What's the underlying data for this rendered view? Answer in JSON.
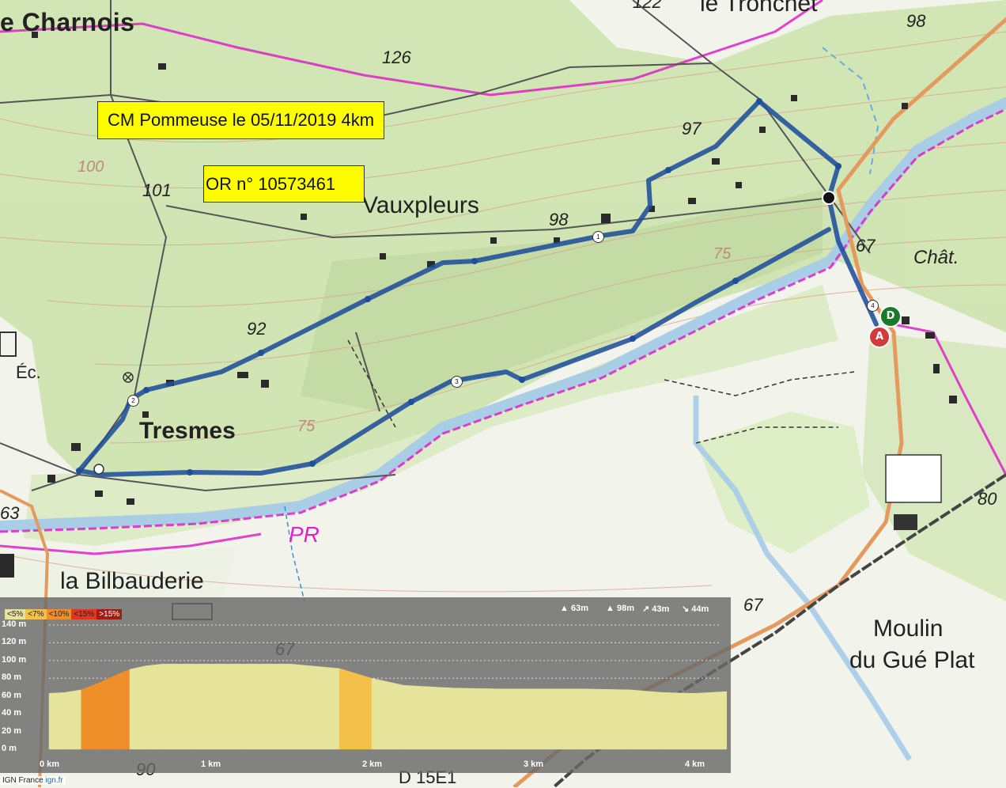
{
  "route": {
    "title": "CM Pommeuse le 05/11/2019 4km",
    "or_number": "OR n° 10573461",
    "color": "#1f4e9c"
  },
  "places": {
    "charnois": "e Charnois",
    "tronchet": "le Tronchet",
    "vauxpleurs": "Vauxpleurs",
    "tresmes": "Tresmes",
    "bilbauderie": "la Bilbauderie",
    "moulin_1": "Moulin",
    "moulin_2": "du Gué Plat",
    "chat": "Chât.",
    "ec": "Éc.",
    "pr": "PR",
    "road": "D 15E1"
  },
  "spot_heights": [
    "126",
    "122",
    "98",
    "97",
    "101",
    "98",
    "92",
    "67",
    "75",
    "75",
    "100",
    "80",
    "67",
    "67",
    "63",
    "90"
  ],
  "markers": {
    "depart": "D",
    "arrivee": "A",
    "waypoints": [
      "1",
      "2",
      "3",
      "4"
    ]
  },
  "elevation_profile": {
    "slope_legend": [
      {
        "label": "<5%",
        "color": "#e6e39a"
      },
      {
        "label": "<7%",
        "color": "#f3c149"
      },
      {
        "label": "<10%",
        "color": "#ef8f29"
      },
      {
        "label": "<15%",
        "color": "#e2371f"
      },
      {
        "label": ">15%",
        "color": "#a11d12"
      }
    ],
    "stats": {
      "min_alt": "63m",
      "max_alt": "98m",
      "ascent": "43m",
      "descent": "44m"
    },
    "y_ticks": [
      "140 m",
      "120 m",
      "100 m",
      "80 m",
      "60 m",
      "40 m",
      "20 m",
      "0 m"
    ],
    "x_ticks": [
      "0 km",
      "1 km",
      "2 km",
      "3 km",
      "4 km"
    ],
    "profile_km": [
      0,
      0.1,
      0.2,
      0.3,
      0.42,
      0.5,
      0.6,
      0.7,
      0.9,
      1.2,
      1.5,
      1.8,
      2.0,
      2.2,
      2.5,
      2.8,
      3.0,
      3.3,
      3.6,
      3.8,
      4.0,
      4.2
    ],
    "profile_alt_m": [
      63,
      64,
      67,
      74,
      84,
      90,
      94,
      96,
      96,
      96,
      96,
      91,
      80,
      72,
      69,
      68,
      68,
      68,
      67,
      64,
      63,
      65
    ]
  },
  "credit": {
    "text": "IGN France",
    "link": "ign.fr"
  }
}
